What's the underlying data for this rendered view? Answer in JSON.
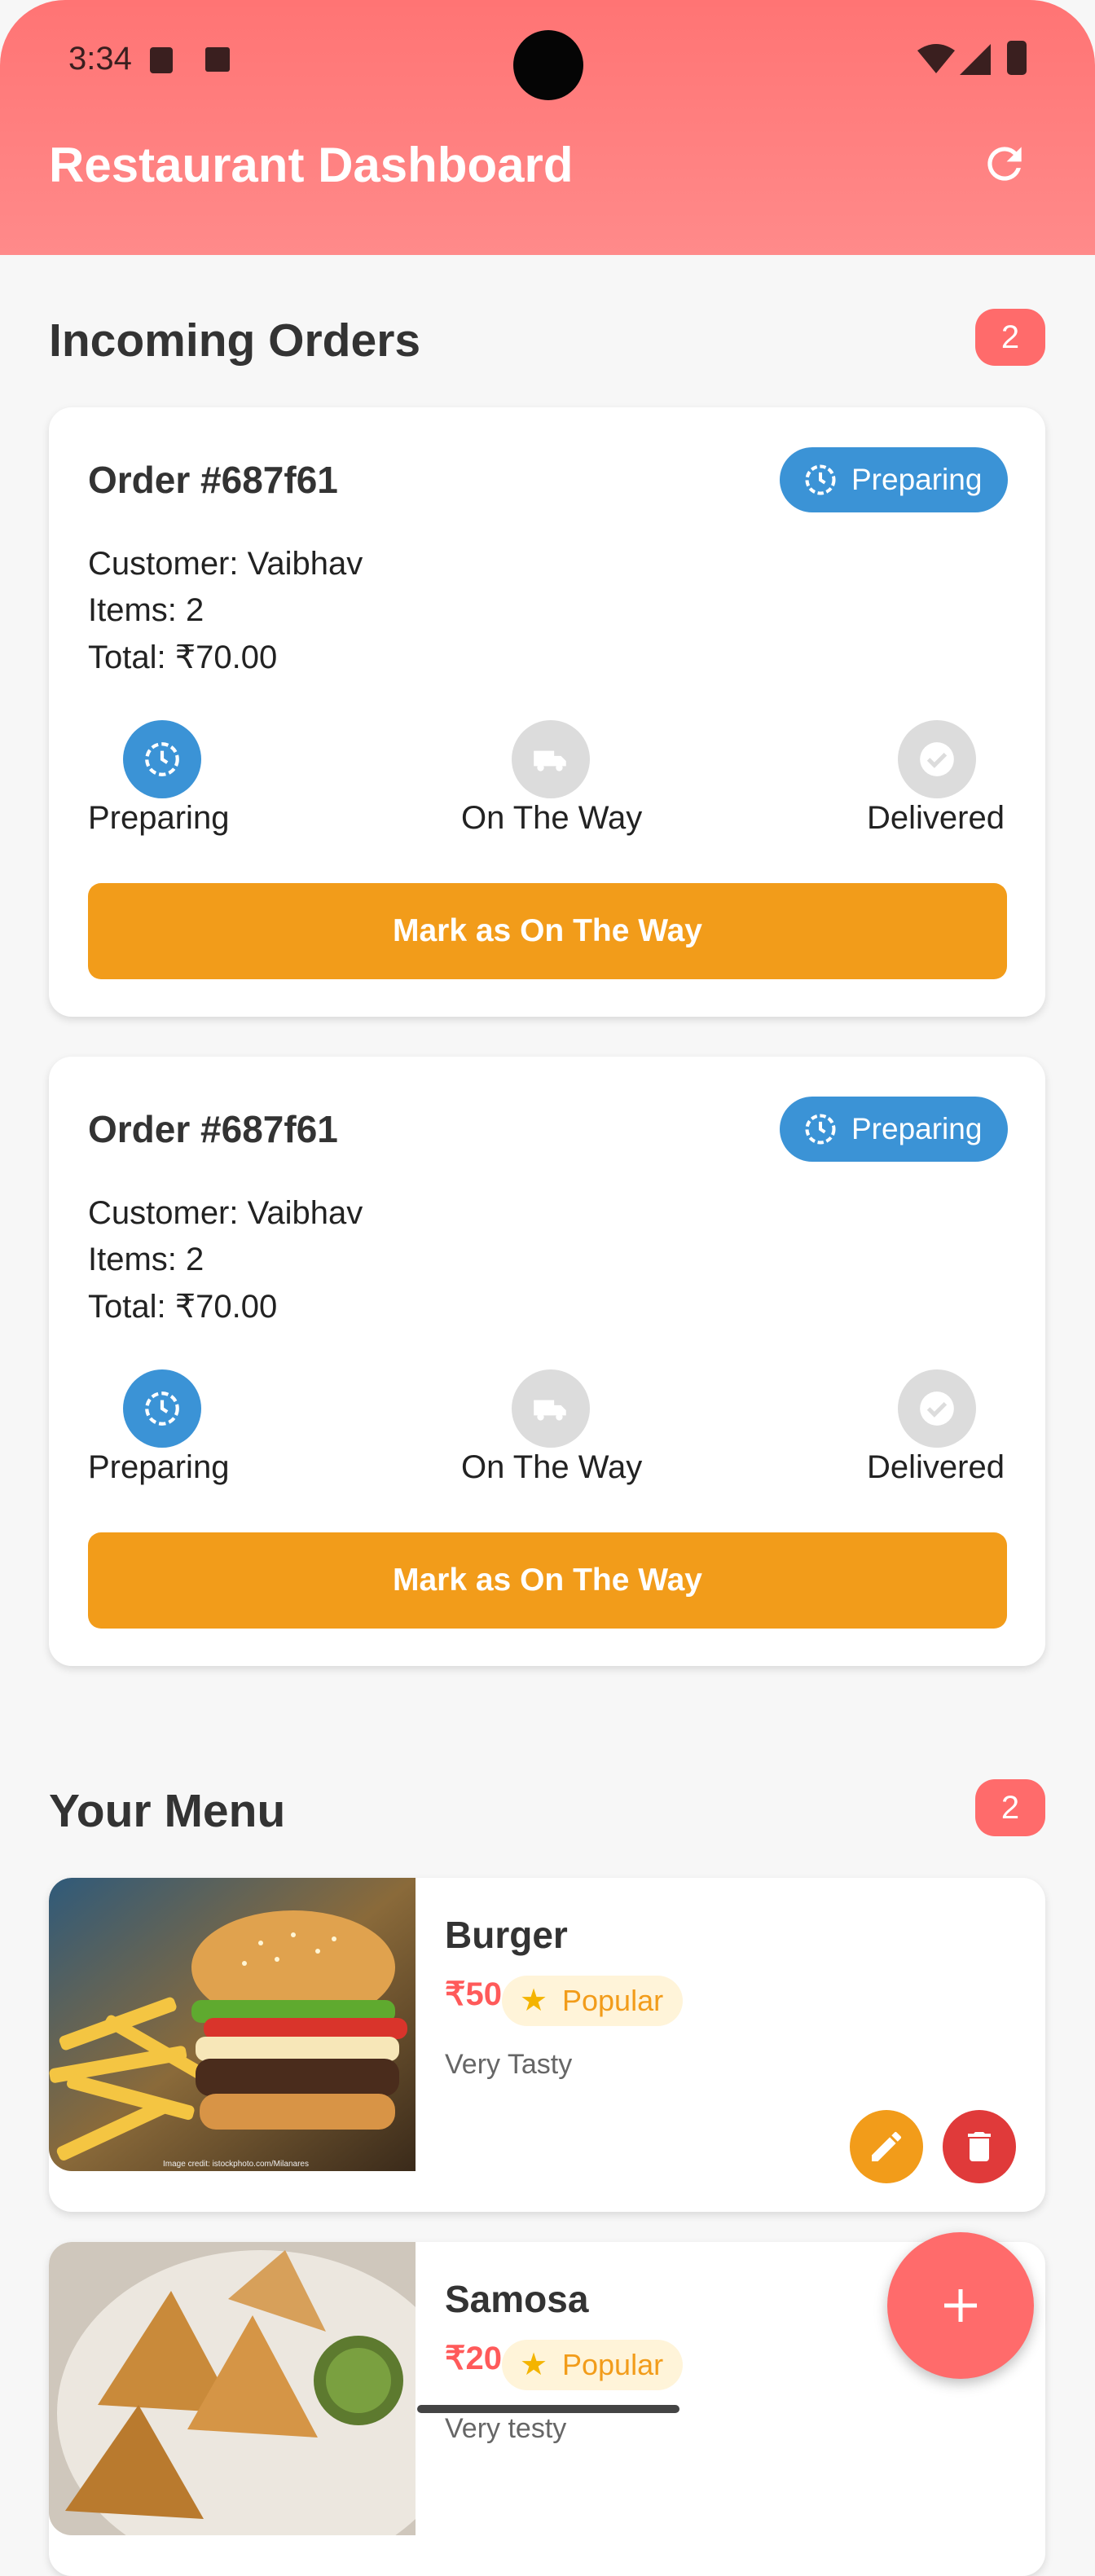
{
  "status_bar": {
    "time": "3:34"
  },
  "header": {
    "title": "Restaurant Dashboard"
  },
  "orders_section": {
    "title": "Incoming Orders",
    "count": "2"
  },
  "orders": [
    {
      "title": "Order #687f61",
      "status": "Preparing",
      "customer": "Customer: Vaibhav",
      "items": "Items: 2",
      "total": "Total: ₹70.00",
      "steps": [
        "Preparing",
        "On The Way",
        "Delivered"
      ],
      "action": "Mark as On The Way"
    },
    {
      "title": "Order #687f61",
      "status": "Preparing",
      "customer": "Customer: Vaibhav",
      "items": "Items: 2",
      "total": "Total: ₹70.00",
      "steps": [
        "Preparing",
        "On The Way",
        "Delivered"
      ],
      "action": "Mark as On The Way"
    }
  ],
  "menu_section": {
    "title": "Your Menu",
    "count": "2"
  },
  "menu": [
    {
      "name": "Burger",
      "price": "₹50",
      "tag": "Popular",
      "description": "Very Tasty",
      "image_credit": "Image credit: istockphoto.com/Milanares"
    },
    {
      "name": "Samosa",
      "price": "₹20",
      "tag": "Popular",
      "description": "Very testy"
    }
  ],
  "colors": {
    "header": "#ff7878",
    "accent_orange": "#f29c1a",
    "status_blue": "#3b93d6",
    "badge_red": "#ff6b6b",
    "price_red": "#ff5a5a"
  },
  "icons": {
    "refresh": "refresh-icon",
    "preparing": "clock-icon",
    "on_the_way": "truck-icon",
    "delivered": "check-icon",
    "edit": "pencil-icon",
    "delete": "trash-icon",
    "add": "plus-icon"
  }
}
